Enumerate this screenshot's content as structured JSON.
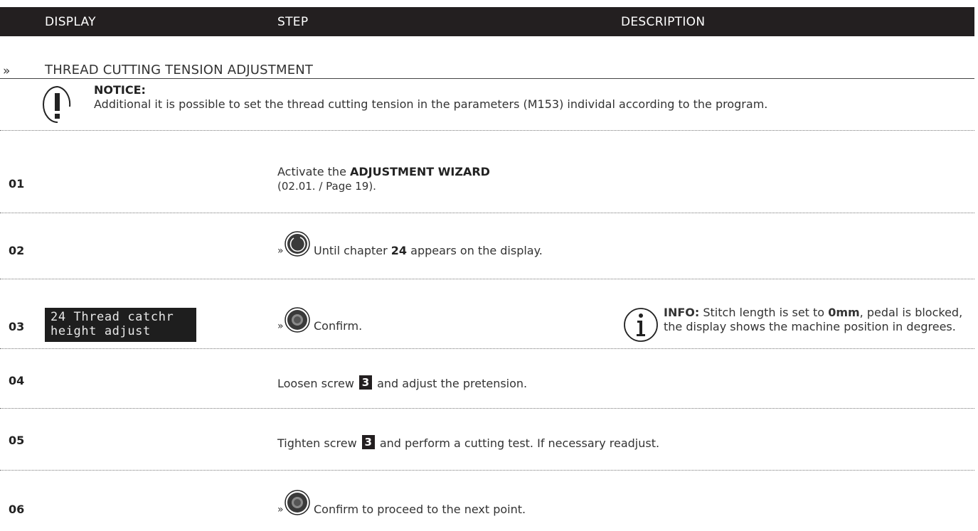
{
  "header": {
    "display": "DISPLAY",
    "step": "STEP",
    "description": "DESCRIPTION"
  },
  "section": {
    "chevron": "»",
    "title": "THREAD CUTTING TENSION ADJUSTMENT"
  },
  "notice": {
    "icon": "exclamation-circle-icon",
    "title": "NOTICE:",
    "text": "Additional it is possible to set the thread cutting tension in the parameters (M153) individal according to the program."
  },
  "steps": [
    {
      "number": "01",
      "pre": "Activate the ",
      "bold": "ADJUSTMENT WIZARD",
      "sub": "(02.01. / Page 19)."
    },
    {
      "number": "02",
      "prefix": "»",
      "knob_icon": "rotate-knob-icon",
      "pre": "Until chapter ",
      "bold": "24",
      "post": " appears on the display."
    },
    {
      "number": "03",
      "display_lines": [
        "24 Thread catchr",
        "height adjust"
      ],
      "prefix": "»",
      "knob_icon": "press-knob-icon",
      "text": "Confirm."
    },
    {
      "number": "04",
      "pre": "Loosen screw ",
      "badge": "3",
      "post": " and adjust the pretension."
    },
    {
      "number": "05",
      "pre": "Tighten screw ",
      "badge": "3",
      "post": " and perform a cutting test. If necessary readjust."
    },
    {
      "number": "06",
      "prefix": "»",
      "knob_icon": "press-knob-icon",
      "text": "Confirm to proceed to the next point."
    }
  ],
  "info": {
    "icon": "info-circle-icon",
    "label": "INFO:",
    "pre": " Stitch length is set to ",
    "bold": "0mm",
    "post": ", pedal is blocked, the display shows the machine position in degrees."
  }
}
